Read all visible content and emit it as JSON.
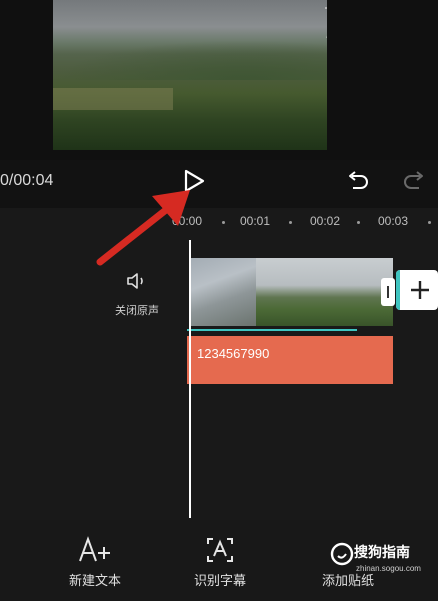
{
  "player": {
    "time_display": "0/00:04"
  },
  "timeline": {
    "ruler_ticks": [
      "00:00",
      "00:01",
      "00:02",
      "00:03"
    ],
    "mute_label": "关闭原声",
    "text_clip": "1234567990"
  },
  "toolbar": {
    "new_text": "新建文本",
    "recognize_subtitles": "识别字幕",
    "add_sticker": "添加贴纸"
  },
  "watermark": {
    "main": "搜狗指南",
    "sub": "zhinan.sogou.com"
  },
  "colors": {
    "accent": "#3fc4c0",
    "text_track": "#e56a4f",
    "annotation_arrow": "#d62a22"
  },
  "icons": {
    "play": "play-icon",
    "undo": "undo-icon",
    "redo": "redo-icon",
    "mute": "speaker-icon",
    "add": "plus-icon",
    "new_text": "text-plus-icon",
    "recognize": "subtitle-recognize-icon"
  }
}
